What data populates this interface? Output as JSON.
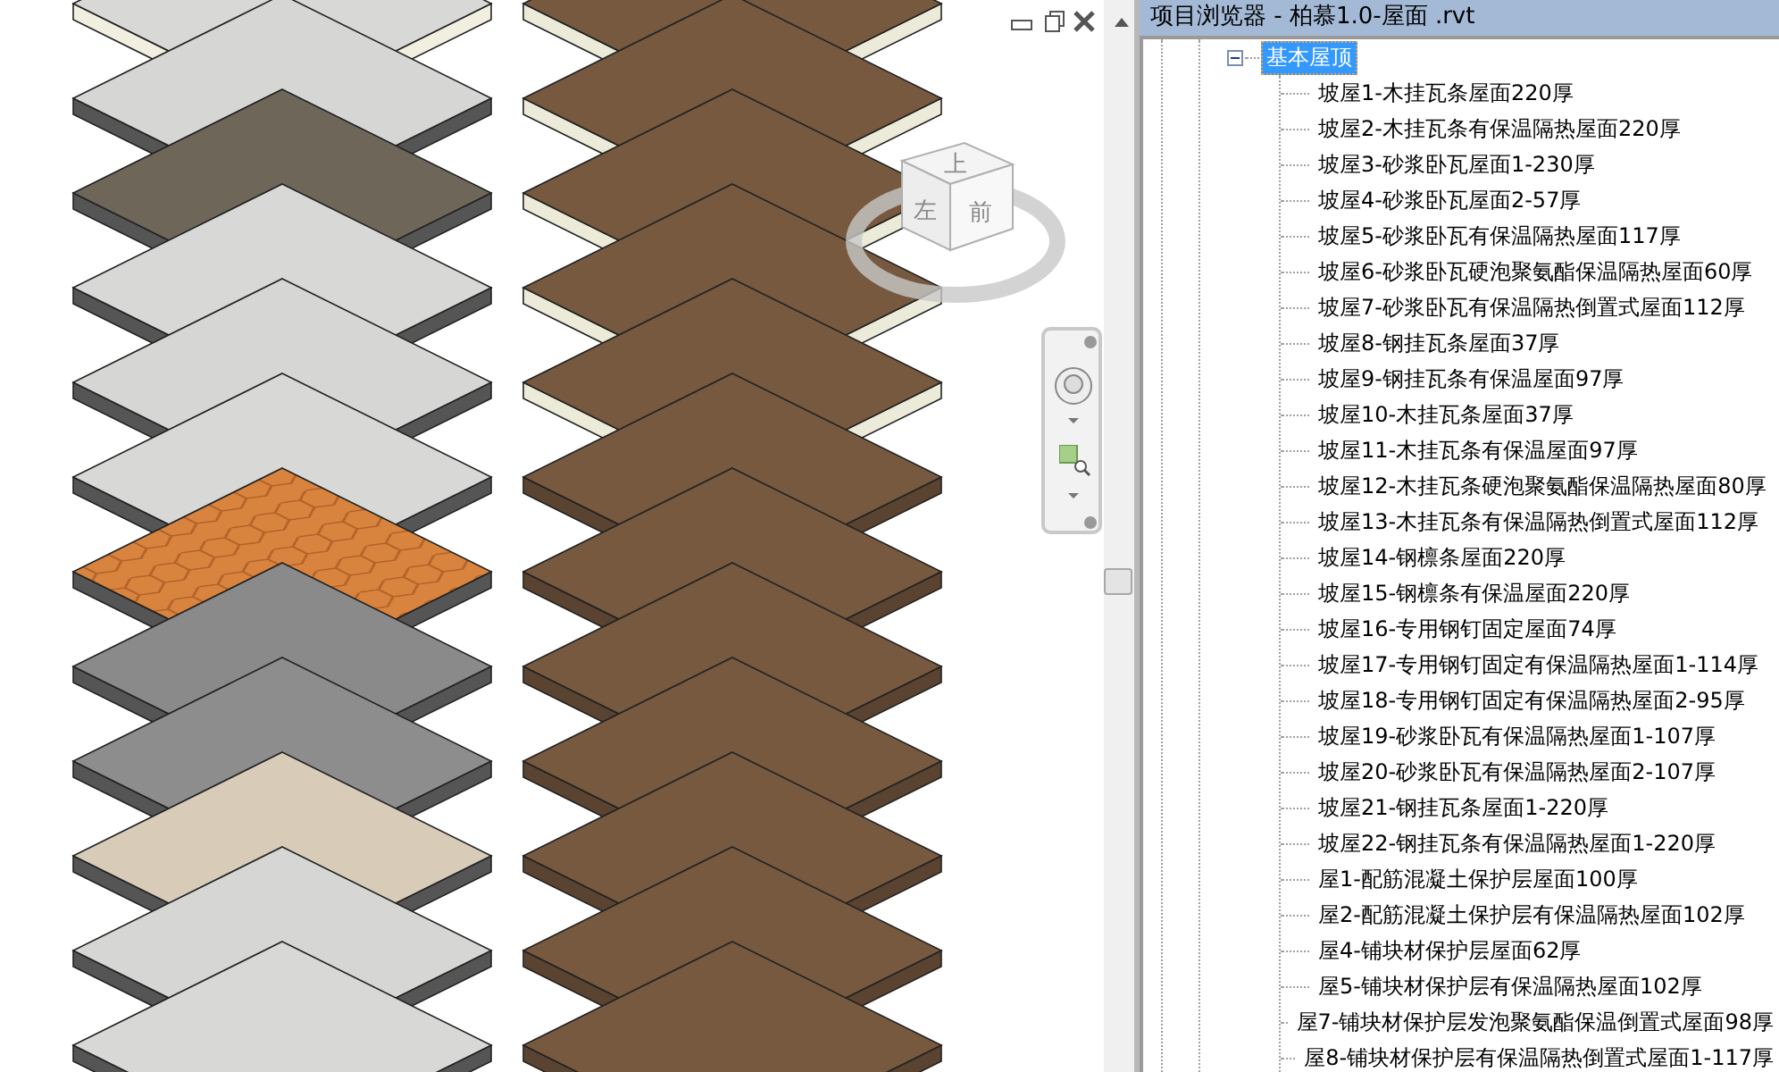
{
  "view": {
    "viewcube": {
      "top": "上",
      "left": "左",
      "front": "前"
    }
  },
  "browser": {
    "title": "项目浏览器 - 柏慕1.0-屋面 .rvt",
    "tree": [
      {
        "label": "基本屋顶",
        "selected": true,
        "expanded": true,
        "children": [
          {
            "label": "坡屋1-木挂瓦条屋面220厚",
            "selected": false
          },
          {
            "label": "坡屋2-木挂瓦条有保温隔热屋面220厚",
            "selected": false
          },
          {
            "label": "坡屋3-砂浆卧瓦屋面1-230厚",
            "selected": false
          },
          {
            "label": "坡屋4-砂浆卧瓦屋面2-57厚",
            "selected": false
          },
          {
            "label": "坡屋5-砂浆卧瓦有保温隔热屋面117厚",
            "selected": false
          },
          {
            "label": "坡屋6-砂浆卧瓦硬泡聚氨酯保温隔热屋面60厚",
            "selected": false
          },
          {
            "label": "坡屋7-砂浆卧瓦有保温隔热倒置式屋面112厚",
            "selected": false
          },
          {
            "label": "坡屋8-钢挂瓦条屋面37厚",
            "selected": false
          },
          {
            "label": "坡屋9-钢挂瓦条有保温屋面97厚",
            "selected": false
          },
          {
            "label": "坡屋10-木挂瓦条屋面37厚",
            "selected": false
          },
          {
            "label": "坡屋11-木挂瓦条有保温屋面97厚",
            "selected": false
          },
          {
            "label": "坡屋12-木挂瓦条硬泡聚氨酯保温隔热屋面80厚",
            "selected": false
          },
          {
            "label": "坡屋13-木挂瓦条有保温隔热倒置式屋面112厚",
            "selected": false
          },
          {
            "label": "坡屋14-钢檩条屋面220厚",
            "selected": false
          },
          {
            "label": "坡屋15-钢檩条有保温屋面220厚",
            "selected": false
          },
          {
            "label": "坡屋16-专用钢钉固定屋面74厚",
            "selected": false
          },
          {
            "label": "坡屋17-专用钢钉固定有保温隔热屋面1-114厚",
            "selected": false
          },
          {
            "label": "坡屋18-专用钢钉固定有保温隔热屋面2-95厚",
            "selected": false
          },
          {
            "label": "坡屋19-砂浆卧瓦有保温隔热屋面1-107厚",
            "selected": false
          },
          {
            "label": "坡屋20-砂浆卧瓦有保温隔热屋面2-107厚",
            "selected": false
          },
          {
            "label": "坡屋21-钢挂瓦条屋面1-220厚",
            "selected": false
          },
          {
            "label": "坡屋22-钢挂瓦条有保温隔热屋面1-220厚",
            "selected": false
          },
          {
            "label": "屋1-配筋混凝土保护层屋面100厚",
            "selected": false
          },
          {
            "label": "屋2-配筋混凝土保护层有保温隔热屋面102厚",
            "selected": false
          },
          {
            "label": "屋4-铺块材保护层屋面62厚",
            "selected": false
          },
          {
            "label": "屋5-铺块材保护层有保温隔热屋面102厚",
            "selected": false
          },
          {
            "label": "屋7-铺块材保护层发泡聚氨酯保温倒置式屋面98厚",
            "selected": false
          },
          {
            "label": "屋8-铺块材保护层有保温隔热倒置式屋面1-117厚",
            "selected": false
          }
        ]
      }
    ]
  }
}
